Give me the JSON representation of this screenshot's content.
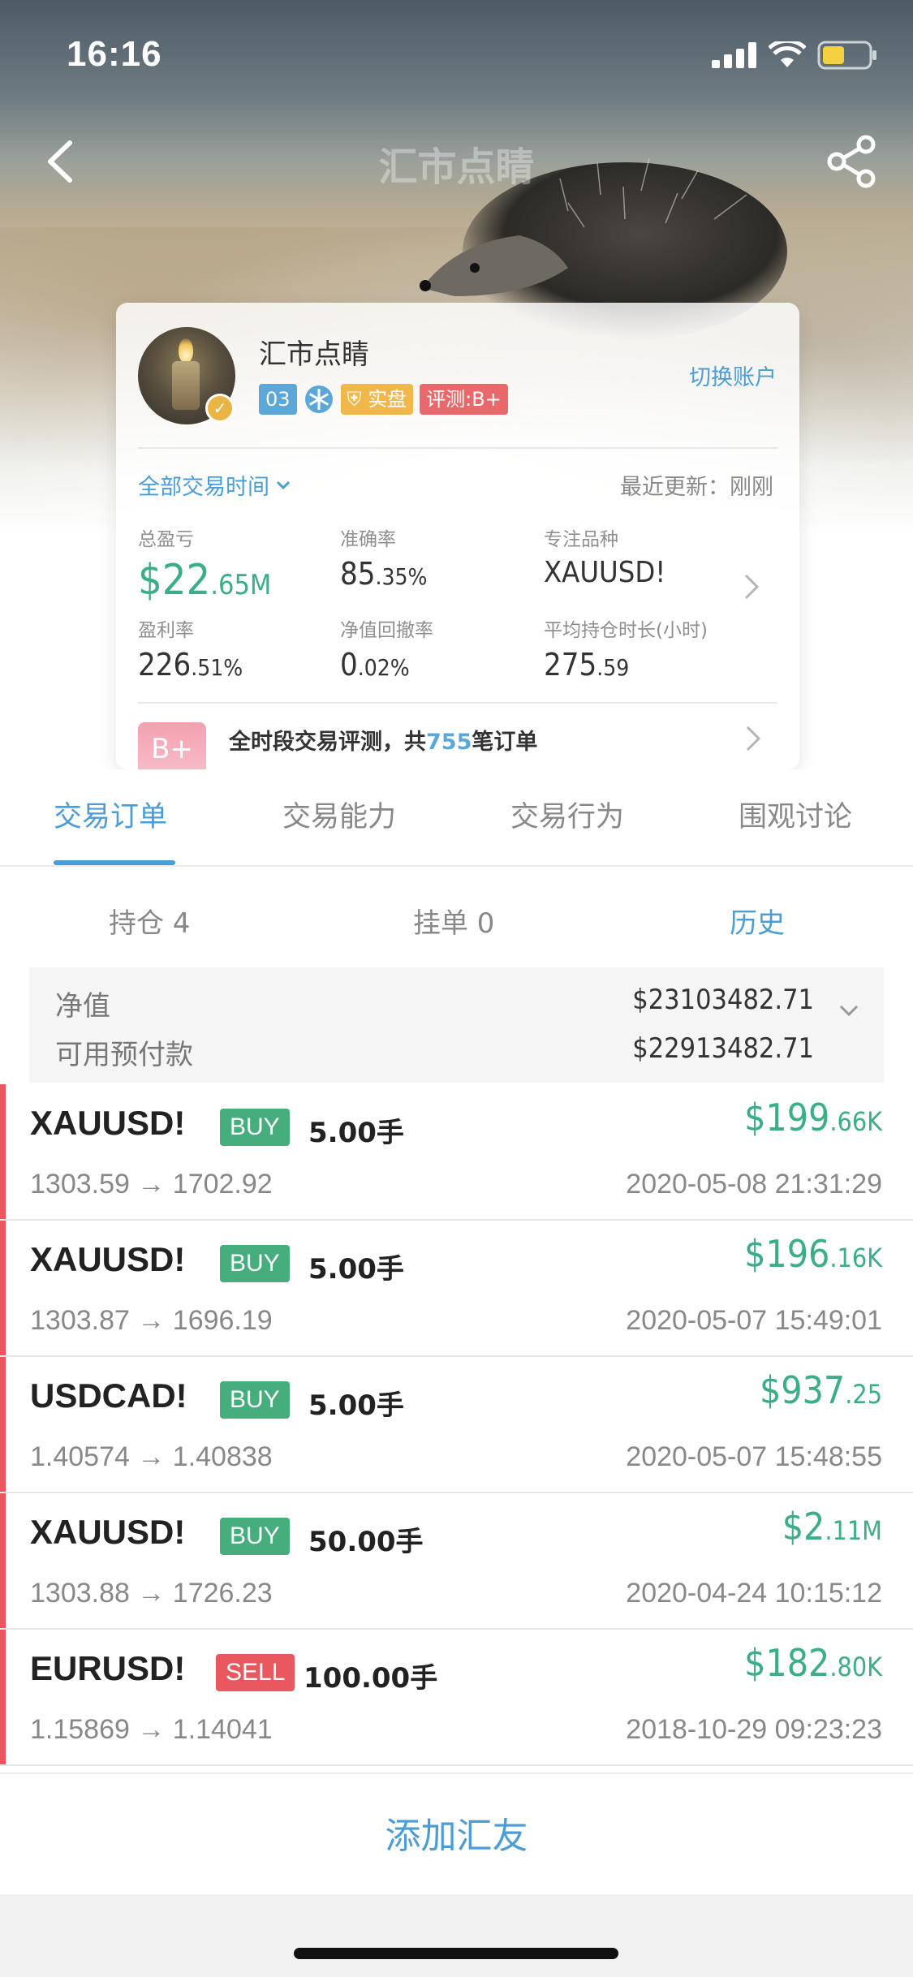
{
  "status_bar": {
    "time": "16:16"
  },
  "nav": {
    "title": "汇市点睛"
  },
  "profile": {
    "name": "汇市点睛",
    "level_badge": "03",
    "real_badge": "实盘",
    "rating_badge": "评测:B+",
    "switch_account": "切换账户",
    "time_filter": "全部交易时间",
    "last_update": "最近更新：刚刚",
    "stats": {
      "total_pnl": {
        "label": "总盈亏",
        "big": "$22",
        "small": ".65M"
      },
      "accuracy": {
        "label": "准确率",
        "big": "85",
        "small": ".35%"
      },
      "focus_symbol": {
        "label": "专注品种",
        "value": "XAUUSD!"
      },
      "profit_rate": {
        "label": "盈利率",
        "big": "226",
        "small": ".51%"
      },
      "drawdown": {
        "label": "净值回撤率",
        "big": "0",
        "small": ".02%"
      },
      "avg_hold": {
        "label": "平均持仓时长(小时)",
        "big": "275",
        "small": ".59"
      }
    },
    "evaluation": {
      "grade": "B+",
      "prefix": "全时段交易评测，共",
      "count": "755",
      "suffix": "笔订单"
    }
  },
  "tabs": [
    "交易订单",
    "交易能力",
    "交易行为",
    "围观讨论"
  ],
  "subtabs": [
    "持仓 4",
    "挂单 0",
    "历史"
  ],
  "summary": {
    "equity_label": "净值",
    "equity_value": "$23103482.71",
    "available_label": "可用预付款",
    "available_value": "$22913482.71"
  },
  "orders": [
    {
      "symbol": "XAUUSD!",
      "side": "BUY",
      "lots": "5.00手",
      "pnl_big": "$199",
      "pnl_small": ".66K",
      "prices": "1303.59 → 1702.92",
      "time": "2020-05-08 21:31:29"
    },
    {
      "symbol": "XAUUSD!",
      "side": "BUY",
      "lots": "5.00手",
      "pnl_big": "$196",
      "pnl_small": ".16K",
      "prices": "1303.87 → 1696.19",
      "time": "2020-05-07 15:49:01"
    },
    {
      "symbol": "USDCAD!",
      "side": "BUY",
      "lots": "5.00手",
      "pnl_big": "$937",
      "pnl_small": ".25",
      "prices": "1.40574 → 1.40838",
      "time": "2020-05-07 15:48:55"
    },
    {
      "symbol": "XAUUSD!",
      "side": "BUY",
      "lots": "50.00手",
      "pnl_big": "$2",
      "pnl_small": ".11M",
      "prices": "1303.88 → 1726.23",
      "time": "2020-04-24 10:15:12"
    },
    {
      "symbol": "EURUSD!",
      "side": "SELL",
      "lots": "100.00手",
      "pnl_big": "$182",
      "pnl_small": ".80K",
      "prices": "1.15869 → 1.14041",
      "time": "2018-10-29 09:23:23"
    }
  ],
  "bottom": {
    "add_friend": "添加汇友"
  },
  "colors": {
    "accent": "#4a9dd6",
    "profit": "#3aae84",
    "buy": "#46ad7c",
    "sell": "#e8585e"
  }
}
